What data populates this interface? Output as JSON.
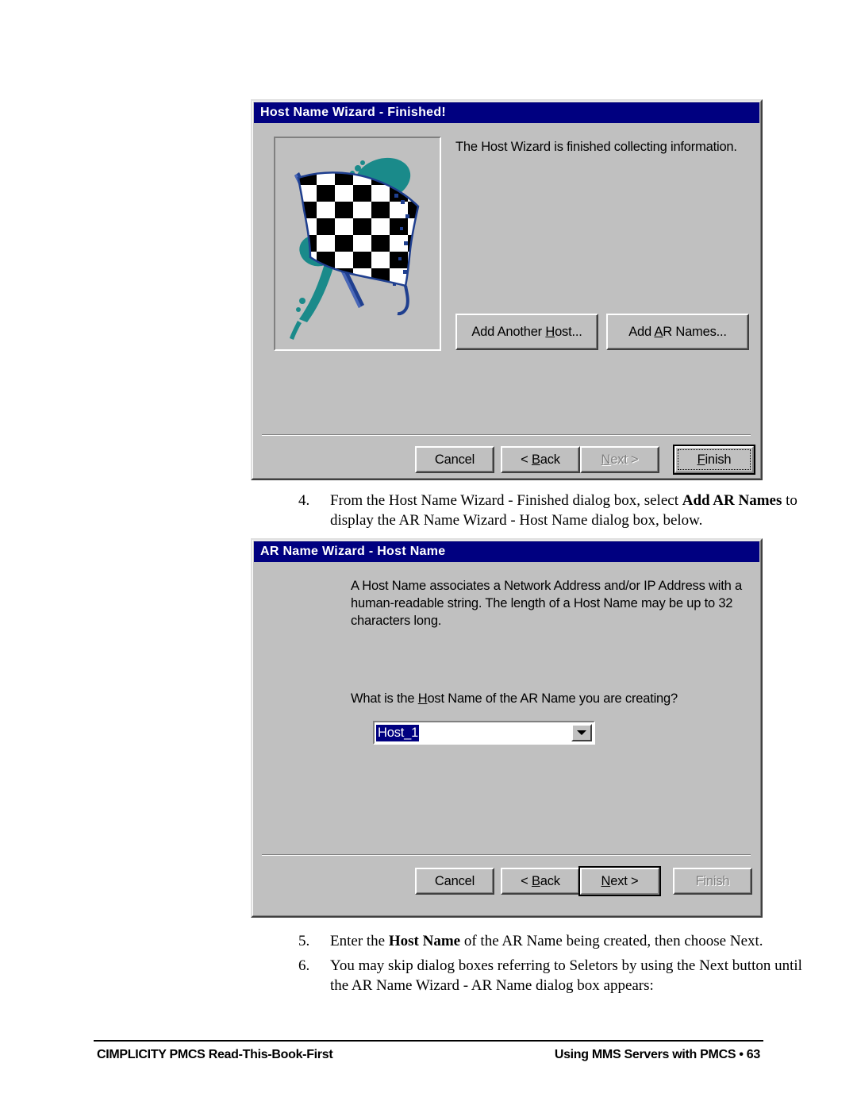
{
  "page": {
    "footer_left": "CIMPLICITY PMCS Read-This-Book-First",
    "footer_right": "Using MMS Servers with PMCS  •  63"
  },
  "dialog_finished": {
    "title": "Host Name Wizard - Finished!",
    "message": "The Host Wizard is finished collecting information.",
    "image_alt": "checkered-racing-flag",
    "buttons": {
      "add_another_host": {
        "pre": "Add Another ",
        "accel": "H",
        "post": "ost..."
      },
      "add_ar_names": {
        "pre": "Add ",
        "accel": "A",
        "post": "R Names..."
      },
      "cancel": {
        "pre": "Cancel",
        "accel": "",
        "post": ""
      },
      "back": {
        "pre": "< ",
        "accel": "B",
        "post": "ack"
      },
      "next": {
        "pre": "",
        "accel": "N",
        "post": "ext >"
      },
      "finish": {
        "pre": "",
        "accel": "F",
        "post": "inish"
      }
    },
    "states": {
      "next_disabled": true,
      "finish_default": true,
      "finish_focused": true
    }
  },
  "dialog_hostname": {
    "title": "AR Name Wizard - Host Name",
    "description_lines": [
      "A Host Name associates a Network Address and/or IP Address with a",
      "human-readable string. The length of a Host Name may be up to 32",
      "characters long."
    ],
    "prompt": {
      "pre": "What is the ",
      "accel": "H",
      "post": "ost Name of the AR Name you are creating?"
    },
    "combo": {
      "value": "Host_1",
      "selected": true,
      "dropdown_icon": "chevron-down-icon"
    },
    "buttons": {
      "cancel": {
        "pre": "Cancel",
        "accel": "",
        "post": ""
      },
      "back": {
        "pre": "< ",
        "accel": "B",
        "post": "ack"
      },
      "next": {
        "pre": "",
        "accel": "N",
        "post": "ext >"
      },
      "finish": {
        "pre": "",
        "accel": "F",
        "post": "inish"
      }
    },
    "states": {
      "finish_disabled": true,
      "next_default": true
    }
  },
  "steps": [
    {
      "number": "4.",
      "parts": [
        {
          "t": "From the Host Name Wizard - Finished dialog box, select ",
          "bold": false
        },
        {
          "t": "Add AR Names",
          "bold": true
        },
        {
          "t": " to display the AR Name Wizard - Host Name dialog box, below.",
          "bold": false
        }
      ]
    },
    {
      "number": "5.",
      "parts": [
        {
          "t": "Enter the ",
          "bold": false
        },
        {
          "t": "Host Name",
          "bold": true
        },
        {
          "t": " of the AR Name being created, then choose Next.",
          "bold": false
        }
      ]
    },
    {
      "number": "6.",
      "parts": [
        {
          "t": "You may skip dialog boxes referring to Seletors by using the Next button until the AR Name Wizard - AR Name dialog box appears:",
          "bold": false
        }
      ]
    }
  ],
  "colors": {
    "title_bar": "#000080",
    "dialog_face": "#c0c0c0",
    "flag_accent": "#1a8a8a",
    "flag_pole": "#1f3f8f",
    "selection": "#000080"
  }
}
